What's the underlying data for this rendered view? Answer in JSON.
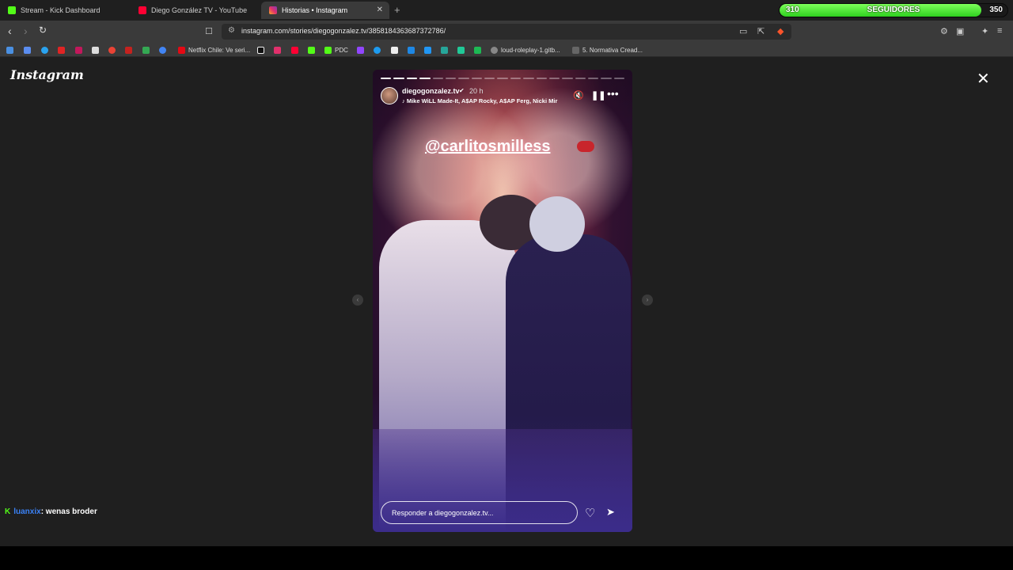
{
  "tabs": [
    {
      "label": "Stream - Kick Dashboard",
      "color": "#53fc18"
    },
    {
      "label": "Diego González TV - YouTube",
      "color": "#ff0033"
    },
    {
      "label": "Historias • Instagram",
      "color": "#e1306c"
    }
  ],
  "followers": {
    "current": "310",
    "label": "SEGUIDORES",
    "goal": "350",
    "fill_fraction": 0.885
  },
  "address": {
    "url": "instagram.com/stories/diegogonzalez.tv/3858184363687372786/"
  },
  "bookmarks": [
    {
      "label": "Netflix Chile: Ve seri...",
      "color": "#e50914"
    },
    {
      "label": "PDC",
      "color": "#53fc18"
    },
    {
      "label": "loud-roleplay-1.gitb...",
      "color": "#888888"
    },
    {
      "label": "5. Normativa Cread...",
      "color": "#666666"
    }
  ],
  "instagram": {
    "logo": "Instagram",
    "story": {
      "username": "diegogonzalez.tv",
      "time": "20 h",
      "song": "Mike WiLL Made-It, A$AP Rocky, A$AP Ferg, Nicki Mir",
      "mention": "@carlitosmilless",
      "reply_placeholder": "Responder a diegogonzalez.tv...",
      "progress_total": 19,
      "progress_done": 4
    }
  },
  "chat": {
    "user": "luanxix",
    "message": ": wenas broder"
  },
  "icons": [
    "close-icon",
    "mute-icon",
    "pause-icon",
    "more-icon",
    "heart-icon",
    "share-icon",
    "prev-arrow-icon",
    "next-arrow-icon"
  ]
}
